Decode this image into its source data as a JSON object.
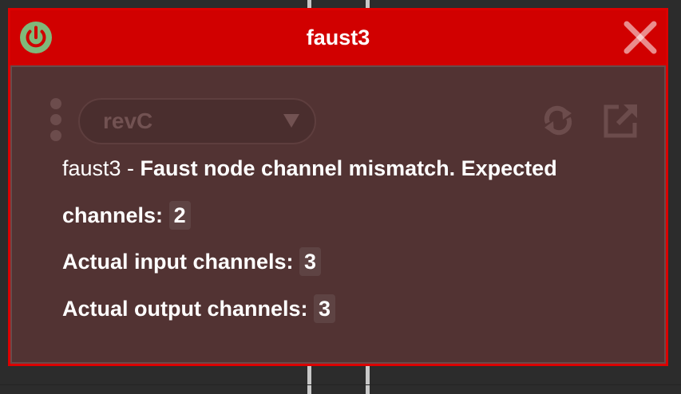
{
  "node": {
    "title": "faust3",
    "accent_color": "#d10000",
    "body_color": "#523333"
  },
  "titlebar": {
    "power_icon": "power-icon",
    "close_icon": "close-icon"
  },
  "toolbar": {
    "dropdown_value": "revC",
    "dropdown_icon": "chevron-down-icon",
    "drag_icon": "drag-handle-icon",
    "refresh_icon": "refresh-icon",
    "external_icon": "external-link-icon"
  },
  "error": {
    "prefix": "faust3 - ",
    "line1": "Faust node channel mismatch. Expected",
    "line2_label": "channels:",
    "expected_channels": "2",
    "line3_label": "Actual input channels:",
    "input_channels": "3",
    "line4_label": "Actual output channels:",
    "output_channels": "3"
  }
}
